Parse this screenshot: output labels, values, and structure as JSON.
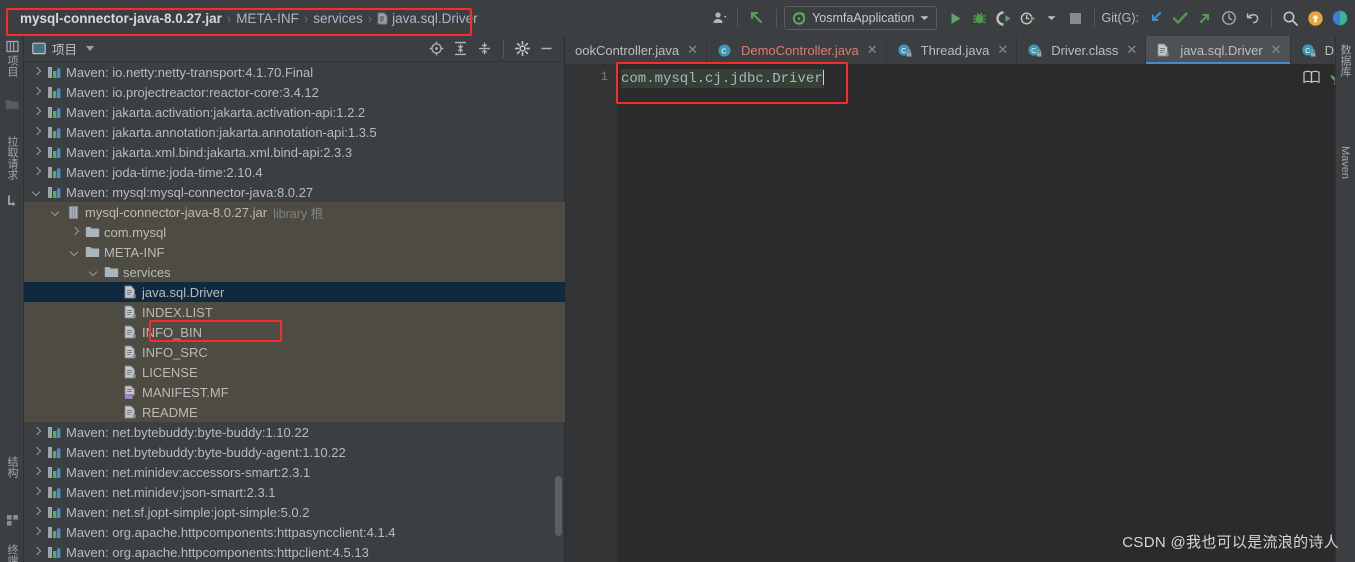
{
  "breadcrumb": {
    "items": [
      {
        "label": "mysql-connector-java-8.0.27.jar",
        "bold": true,
        "icon": ""
      },
      {
        "label": "META-INF",
        "bold": false,
        "icon": ""
      },
      {
        "label": "services",
        "bold": false,
        "icon": ""
      },
      {
        "label": "java.sql.Driver",
        "bold": false,
        "icon": "file-icon"
      }
    ],
    "separator": "›"
  },
  "toolbar": {
    "avatar_icon": "user-icon",
    "back_icon": "arrow-up-left-icon",
    "run_config": "YosmfaApplication",
    "run_config_icon": "spring-boot-icon",
    "run_icon": "run-icon",
    "debug_icon": "debug-icon",
    "run_coverage_icon": "run-with-coverage-icon",
    "profiler_icon": "profiler-icon",
    "stop_icon": "stop-icon",
    "git_label": "Git(G):",
    "git_update_icon": "update-project-icon",
    "git_commit_icon": "commit-icon",
    "git_push_icon": "push-icon",
    "history_icon": "history-icon",
    "undo_icon": "undo-icon",
    "search_icon": "search-icon",
    "notification_icon": "notification-icon",
    "ide_icon": "ide-icon"
  },
  "left_rail": {
    "items": [
      {
        "label": "项目",
        "name": "tool-window-project"
      },
      {
        "label": "",
        "name": "tool-window-folder"
      },
      {
        "label": "拉取请求",
        "name": "tool-window-pull-requests"
      },
      {
        "label": "",
        "name": "tool-window-commit"
      },
      {
        "label": "结构",
        "name": "tool-window-structure"
      },
      {
        "label": "",
        "name": "tool-window-favorites"
      },
      {
        "label": "终端",
        "name": "tool-window-terminal"
      }
    ]
  },
  "right_rail": {
    "items": [
      {
        "label": "数据库",
        "name": "tool-window-database"
      },
      {
        "label": "Maven",
        "name": "tool-window-maven"
      }
    ]
  },
  "project_panel": {
    "title": "项目",
    "title_icon": "project-icon",
    "dropdown_icon": "chevron-down-icon",
    "tools": [
      {
        "name": "scroll-from-source-icon",
        "glyph": "target"
      },
      {
        "name": "expand-all-icon",
        "glyph": "expand"
      },
      {
        "name": "collapse-all-icon",
        "glyph": "collapse"
      },
      {
        "name": "settings-gear-icon",
        "glyph": "gear"
      },
      {
        "name": "hide-panel-icon",
        "glyph": "minus"
      }
    ],
    "tree": [
      {
        "indent": 0,
        "arrow": "right",
        "icon": "maven-icon",
        "label": "Maven: io.netty:netty-transport:4.1.70.Final",
        "style": "normal"
      },
      {
        "indent": 0,
        "arrow": "right",
        "icon": "maven-icon",
        "label": "Maven: io.projectreactor:reactor-core:3.4.12",
        "style": "normal"
      },
      {
        "indent": 0,
        "arrow": "right",
        "icon": "maven-icon",
        "label": "Maven: jakarta.activation:jakarta.activation-api:1.2.2",
        "style": "normal"
      },
      {
        "indent": 0,
        "arrow": "right",
        "icon": "maven-icon",
        "label": "Maven: jakarta.annotation:jakarta.annotation-api:1.3.5",
        "style": "normal"
      },
      {
        "indent": 0,
        "arrow": "right",
        "icon": "maven-icon",
        "label": "Maven: jakarta.xml.bind:jakarta.xml.bind-api:2.3.3",
        "style": "normal"
      },
      {
        "indent": 0,
        "arrow": "right",
        "icon": "maven-icon",
        "label": "Maven: joda-time:joda-time:2.10.4",
        "style": "normal"
      },
      {
        "indent": 0,
        "arrow": "down",
        "icon": "maven-icon",
        "label": "Maven: mysql:mysql-connector-java:8.0.27",
        "style": "normal"
      },
      {
        "indent": 1,
        "arrow": "down",
        "icon": "jar-icon",
        "label": "mysql-connector-java-8.0.27.jar",
        "suffix": "library 根",
        "style": "lib"
      },
      {
        "indent": 2,
        "arrow": "right",
        "icon": "folder-icon",
        "label": "com.mysql",
        "style": "lib"
      },
      {
        "indent": 2,
        "arrow": "down",
        "icon": "folder-icon",
        "label": "META-INF",
        "style": "lib"
      },
      {
        "indent": 3,
        "arrow": "down",
        "icon": "folder-icon",
        "label": "services",
        "style": "lib"
      },
      {
        "indent": 4,
        "arrow": "none",
        "icon": "file-icon",
        "label": "java.sql.Driver",
        "style": "selected"
      },
      {
        "indent": 4,
        "arrow": "none",
        "icon": "file-icon",
        "label": "INDEX.LIST",
        "style": "lib"
      },
      {
        "indent": 4,
        "arrow": "none",
        "icon": "file-icon",
        "label": "INFO_BIN",
        "style": "lib"
      },
      {
        "indent": 4,
        "arrow": "none",
        "icon": "file-icon",
        "label": "INFO_SRC",
        "style": "lib"
      },
      {
        "indent": 4,
        "arrow": "none",
        "icon": "file-icon",
        "label": "LICENSE",
        "style": "lib"
      },
      {
        "indent": 4,
        "arrow": "none",
        "icon": "manifest-icon",
        "label": "MANIFEST.MF",
        "style": "lib"
      },
      {
        "indent": 4,
        "arrow": "none",
        "icon": "file-icon",
        "label": "README",
        "style": "lib"
      },
      {
        "indent": 0,
        "arrow": "right",
        "icon": "maven-icon",
        "label": "Maven: net.bytebuddy:byte-buddy:1.10.22",
        "style": "normal"
      },
      {
        "indent": 0,
        "arrow": "right",
        "icon": "maven-icon",
        "label": "Maven: net.bytebuddy:byte-buddy-agent:1.10.22",
        "style": "normal"
      },
      {
        "indent": 0,
        "arrow": "right",
        "icon": "maven-icon",
        "label": "Maven: net.minidev:accessors-smart:2.3.1",
        "style": "normal"
      },
      {
        "indent": 0,
        "arrow": "right",
        "icon": "maven-icon",
        "label": "Maven: net.minidev:json-smart:2.3.1",
        "style": "normal"
      },
      {
        "indent": 0,
        "arrow": "right",
        "icon": "maven-icon",
        "label": "Maven: net.sf.jopt-simple:jopt-simple:5.0.2",
        "style": "normal"
      },
      {
        "indent": 0,
        "arrow": "right",
        "icon": "maven-icon",
        "label": "Maven: org.apache.httpcomponents:httpasyncclient:4.1.4",
        "style": "normal"
      },
      {
        "indent": 0,
        "arrow": "right",
        "icon": "maven-icon",
        "label": "Maven: org.apache.httpcomponents:httpclient:4.5.13",
        "style": "normal"
      }
    ]
  },
  "editor": {
    "tabs": [
      {
        "label": "ookController.java",
        "icon": "class-icon",
        "active": false,
        "modified": false,
        "closable": true
      },
      {
        "label": "DemoController.java",
        "icon": "class-icon",
        "active": false,
        "modified": true,
        "closable": true
      },
      {
        "label": "Thread.java",
        "icon": "class-locked-icon",
        "active": false,
        "modified": false,
        "closable": true
      },
      {
        "label": "Driver.class",
        "icon": "class-locked-icon",
        "active": false,
        "modified": false,
        "closable": true
      },
      {
        "label": "java.sql.Driver",
        "icon": "file-icon",
        "active": true,
        "modified": false,
        "closable": true
      },
      {
        "label": "DriverMa",
        "icon": "class-locked-icon",
        "active": false,
        "modified": false,
        "closable": false
      }
    ],
    "tabs_overflow_icon": "chevron-down-icon",
    "line_number": "1",
    "content": "com.mysql.cj.jdbc.Driver",
    "reader_mode_icon": "reader-mode-icon",
    "inspection_ok_icon": "inspections-ok-icon"
  },
  "watermark": "CSDN @我也可以是流浪的诗人",
  "colors": {
    "accent_red": "#fb2b2b",
    "selection": "#10293e",
    "library_bg": "#4e4b42",
    "panel_bg": "#3c3f41",
    "editor_bg": "#2b2b2b",
    "tab_active": "#4e5254",
    "tab_underline": "#4a88c7",
    "code_fg": "#a9b7c6",
    "code_highlight": "#344134",
    "green": "#5aa15a",
    "blue": "#4a88c7"
  }
}
